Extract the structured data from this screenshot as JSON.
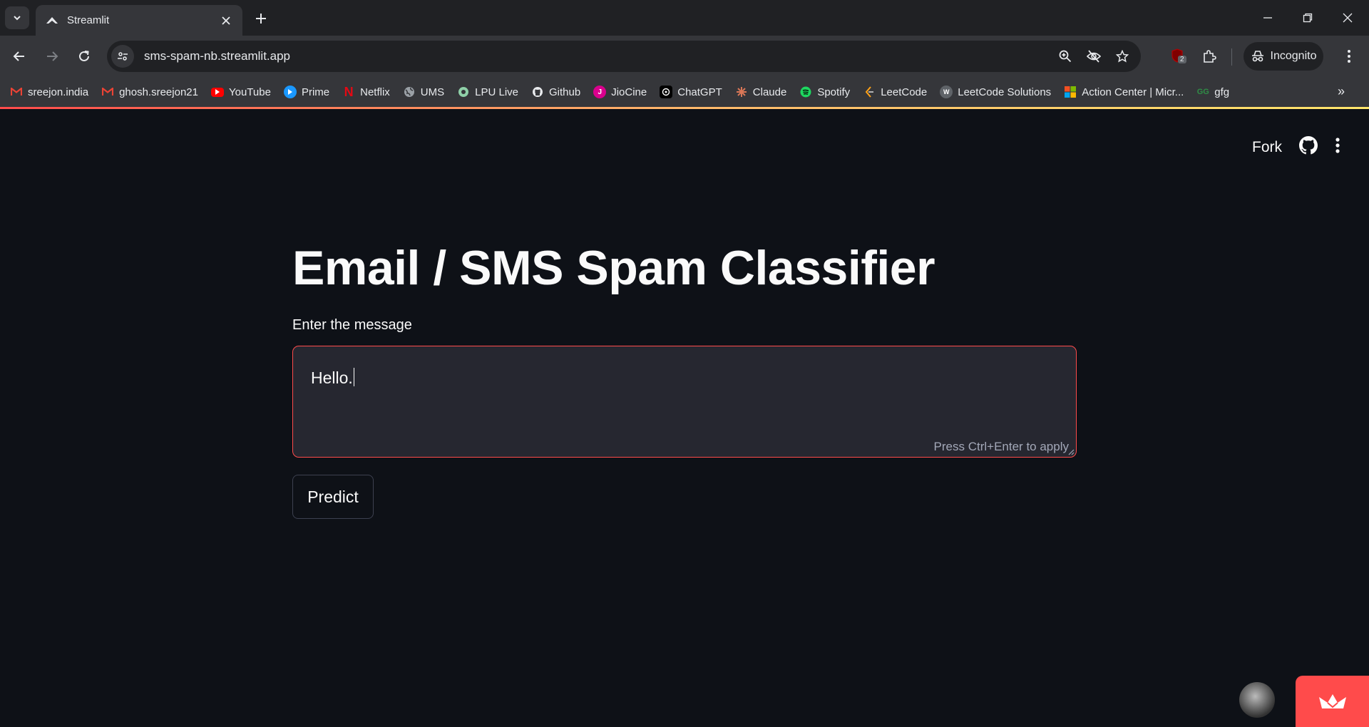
{
  "browser": {
    "tab": {
      "title": "Streamlit"
    },
    "url": "sms-spam-nb.streamlit.app",
    "incognito_label": "Incognito",
    "extension_badge": "2",
    "bookmarks": [
      {
        "label": "sreejon.india",
        "icon": "gmail-icon"
      },
      {
        "label": "ghosh.sreejon21",
        "icon": "gmail-icon"
      },
      {
        "label": "YouTube",
        "icon": "youtube-icon"
      },
      {
        "label": "Prime",
        "icon": "prime-icon"
      },
      {
        "label": "Netflix",
        "icon": "netflix-icon"
      },
      {
        "label": "UMS",
        "icon": "globe-icon"
      },
      {
        "label": "LPU Live",
        "icon": "chat-icon"
      },
      {
        "label": "Github",
        "icon": "github-icon"
      },
      {
        "label": "JioCine",
        "icon": "jiocine-icon"
      },
      {
        "label": "ChatGPT",
        "icon": "chatgpt-icon"
      },
      {
        "label": "Claude",
        "icon": "claude-icon"
      },
      {
        "label": "Spotify",
        "icon": "spotify-icon"
      },
      {
        "label": "LeetCode",
        "icon": "leetcode-icon"
      },
      {
        "label": "LeetCode Solutions",
        "icon": "walkccc-icon"
      },
      {
        "label": "Action Center | Micr...",
        "icon": "microsoft-icon"
      },
      {
        "label": "gfg",
        "icon": "gfg-icon"
      }
    ]
  },
  "app": {
    "header": {
      "fork_label": "Fork"
    },
    "title": "Email / SMS Spam Classifier",
    "input_label": "Enter the message",
    "input_value": "Hello.",
    "input_hint": "Press Ctrl+Enter to apply",
    "predict_label": "Predict"
  },
  "colors": {
    "app_bg": "#0e1117",
    "accent": "#ff4b4b",
    "textarea_bg": "#262730",
    "chrome_dark": "#202124",
    "chrome_toolbar": "#35363a"
  }
}
